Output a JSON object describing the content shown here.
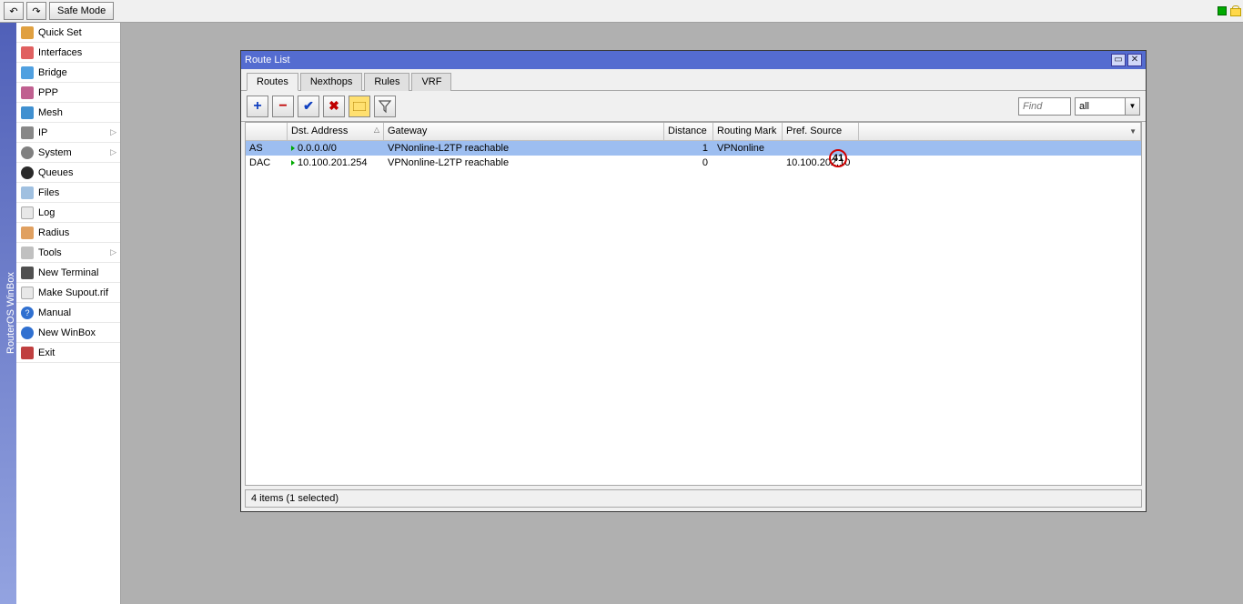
{
  "top": {
    "undo": "↶",
    "redo": "↷",
    "safemode": "Safe Mode"
  },
  "app_label": "RouterOS WinBox",
  "menu": {
    "items": [
      {
        "label": "Quick Set",
        "icon": "ic-quickset",
        "sub": false
      },
      {
        "label": "Interfaces",
        "icon": "ic-interfaces",
        "sub": false
      },
      {
        "label": "Bridge",
        "icon": "ic-bridge",
        "sub": false
      },
      {
        "label": "PPP",
        "icon": "ic-ppp",
        "sub": false
      },
      {
        "label": "Mesh",
        "icon": "ic-mesh",
        "sub": false
      },
      {
        "label": "IP",
        "icon": "ic-ip",
        "sub": true
      },
      {
        "label": "System",
        "icon": "ic-system",
        "sub": true
      },
      {
        "label": "Queues",
        "icon": "ic-queues",
        "sub": false
      },
      {
        "label": "Files",
        "icon": "ic-files",
        "sub": false
      },
      {
        "label": "Log",
        "icon": "ic-log",
        "sub": false
      },
      {
        "label": "Radius",
        "icon": "ic-radius",
        "sub": false
      },
      {
        "label": "Tools",
        "icon": "ic-tools",
        "sub": true
      },
      {
        "label": "New Terminal",
        "icon": "ic-terminal",
        "sub": false
      },
      {
        "label": "Make Supout.rif",
        "icon": "ic-supout",
        "sub": false
      },
      {
        "label": "Manual",
        "icon": "ic-manual",
        "sub": false
      },
      {
        "label": "New WinBox",
        "icon": "ic-winbox",
        "sub": false
      },
      {
        "label": "Exit",
        "icon": "ic-exit",
        "sub": false
      }
    ]
  },
  "window": {
    "title": "Route List",
    "tabs": {
      "routes": "Routes",
      "nexthops": "Nexthops",
      "rules": "Rules",
      "vrf": "VRF"
    },
    "toolbar": {
      "add": "+",
      "remove": "−",
      "enable": "✔",
      "disable": "✖",
      "find_placeholder": "Find",
      "filter_value": "all"
    },
    "columns": {
      "dst": "Dst. Address",
      "gw": "Gateway",
      "dist": "Distance",
      "rmark": "Routing Mark",
      "psrc": "Pref. Source"
    },
    "rows": [
      {
        "flags": "AS",
        "dst": "0.0.0.0/0",
        "gateway": "VPNonline-L2TP reachable",
        "distance": "1",
        "rmark": "VPNonline",
        "psrc": "",
        "selected": true
      },
      {
        "flags": "DAC",
        "dst": "10.100.201.254",
        "gateway": "VPNonline-L2TP reachable",
        "distance": "0",
        "rmark": "",
        "psrc": "10.100.202.10",
        "selected": false
      }
    ],
    "annotation": "41",
    "status": "4 items (1 selected)"
  }
}
